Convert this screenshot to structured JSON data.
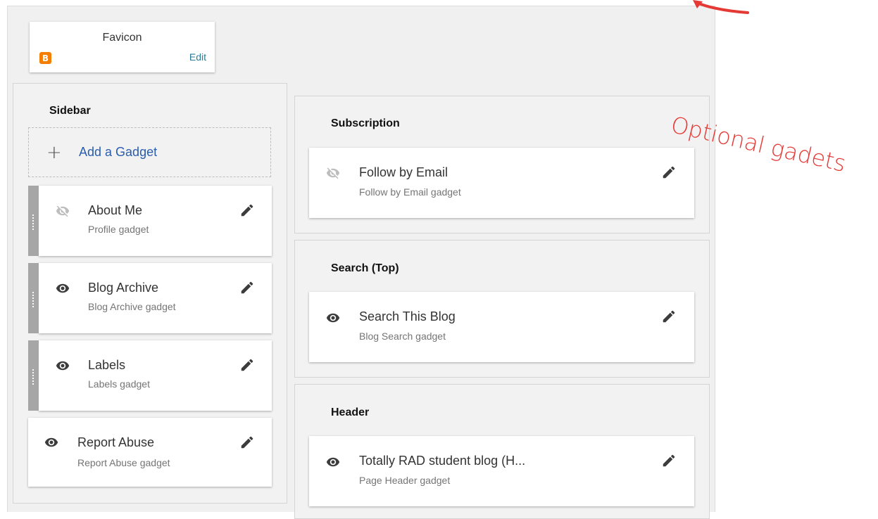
{
  "favicon": {
    "title": "Favicon",
    "edit_label": "Edit",
    "logo_letter": "B"
  },
  "sidebar": {
    "title": "Sidebar",
    "add_gadget": {
      "plus": "+",
      "label": "Add a Gadget"
    },
    "gadgets": [
      {
        "title": "About Me",
        "subtitle": "Profile gadget",
        "visibility": "hidden"
      },
      {
        "title": "Blog Archive",
        "subtitle": "Blog Archive gadget",
        "visibility": "visible"
      },
      {
        "title": "Labels",
        "subtitle": "Labels gadget",
        "visibility": "visible"
      },
      {
        "title": "Report Abuse",
        "subtitle": "Report Abuse gadget",
        "visibility": "visible"
      }
    ]
  },
  "sections": [
    {
      "title": "Subscription",
      "gadget": {
        "title": "Follow by Email",
        "subtitle": "Follow by Email gadget",
        "visibility": "hidden"
      }
    },
    {
      "title": "Search (Top)",
      "gadget": {
        "title": "Search This Blog",
        "subtitle": "Blog Search gadget",
        "visibility": "visible"
      }
    },
    {
      "title": "Header",
      "gadget": {
        "title": "Totally RAD student blog (H...",
        "subtitle": "Page Header gadget",
        "visibility": "visible"
      }
    }
  ],
  "annotation": {
    "text": "Optional gadets",
    "color": "#e53935"
  },
  "colors": {
    "link": "#2a5db0",
    "edit": "#2a7a96",
    "blogger": "#f57d00",
    "handle": "#a6a6a6"
  }
}
